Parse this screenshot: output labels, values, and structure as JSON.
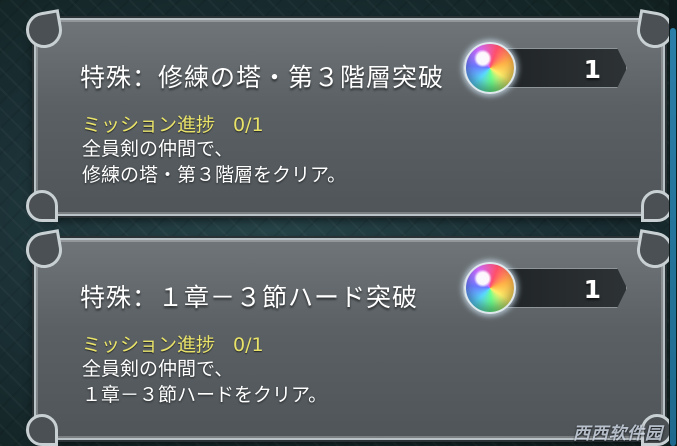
{
  "missions": [
    {
      "title": "特殊：修練の塔・第３階層突破",
      "reward_icon": "rainbow-orb-icon",
      "reward_count": "1",
      "progress_label": "ミッション進捗",
      "progress_value": "0/1",
      "description_line1": "全員剣の仲間で、",
      "description_line2": "修練の塔・第３階層をクリア。"
    },
    {
      "title": "特殊：１章－３節ハード突破",
      "reward_icon": "rainbow-orb-icon",
      "reward_count": "1",
      "progress_label": "ミッション進捗",
      "progress_value": "0/1",
      "description_line1": "全員剣の仲間で、",
      "description_line2": "１章－３節ハードをクリア。"
    }
  ],
  "watermark": "西西软件园",
  "colors": {
    "progress_text": "#e9e36a",
    "card_border": "#b9c2c6",
    "scrollbar": "#2a7fa8"
  }
}
